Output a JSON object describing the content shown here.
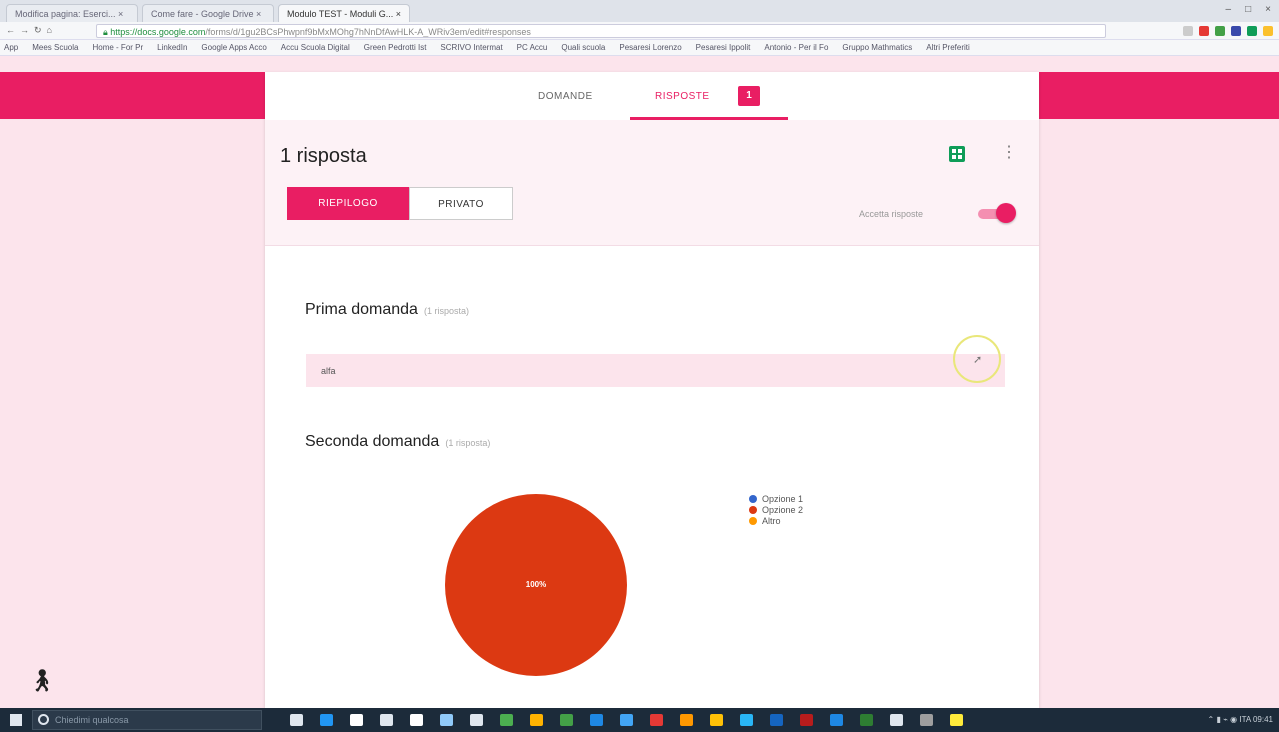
{
  "browser": {
    "tabs": [
      {
        "label": "Modifica pagina: Eserci... ×",
        "active": false
      },
      {
        "label": "Come fare - Google Drive ×",
        "active": false
      },
      {
        "label": "Modulo TEST - Moduli G... ×",
        "active": true
      }
    ],
    "url_secure": "https://docs.google.com",
    "url_rest": "/forms/d/1gu2BCsPhwpnf9bMxMOhg7hNnDfAwHLK-A_WRiv3em/edit#responses",
    "bookmarks": [
      "App",
      "Mees Scuola",
      "Home - For Pr",
      "LinkedIn",
      "Google Apps Acco",
      "Accu Scuola Digital",
      "Green Pedrotti Ist",
      "SCRIVO Intermat",
      "PC Accu",
      "Quali scuola",
      "Pesaresi Lorenzo",
      "Pesaresi Ippolit",
      "Antonio - Per il Fo",
      "Gruppo Mathmatics",
      "Altri Preferiti"
    ],
    "window_controls": [
      "–",
      "□",
      "×"
    ]
  },
  "form_tabs": {
    "questions": "DOMANDE",
    "responses": "RISPOSTE",
    "responses_badge": "1"
  },
  "summary": {
    "title": "1 risposta",
    "seg_summary": "RIEPILOGO",
    "seg_individual": "PRIVATO",
    "accept_label": "Accetta risposte",
    "accepting": true
  },
  "questions": [
    {
      "title": "Prima domanda",
      "count": "(1 risposta)",
      "answer": "alfa"
    },
    {
      "title": "Seconda domanda",
      "count": "(1 risposta)"
    }
  ],
  "chart_data": {
    "type": "pie",
    "categories": [
      "Opzione 1",
      "Opzione 2",
      "Altro"
    ],
    "values": [
      0,
      100,
      0
    ],
    "slice_label": "100%",
    "colors": [
      "#3366cc",
      "#dc3912",
      "#ff9900"
    ],
    "legend": "right"
  },
  "taskbar": {
    "search_placeholder": "Chiedimi qualcosa",
    "tray": "⌃ ▮ ⌁ ◉ ITA 09:41"
  },
  "colors": {
    "accent": "#e91e63",
    "accent_light": "#fce4ec",
    "sheets_green": "#0f9d58"
  }
}
